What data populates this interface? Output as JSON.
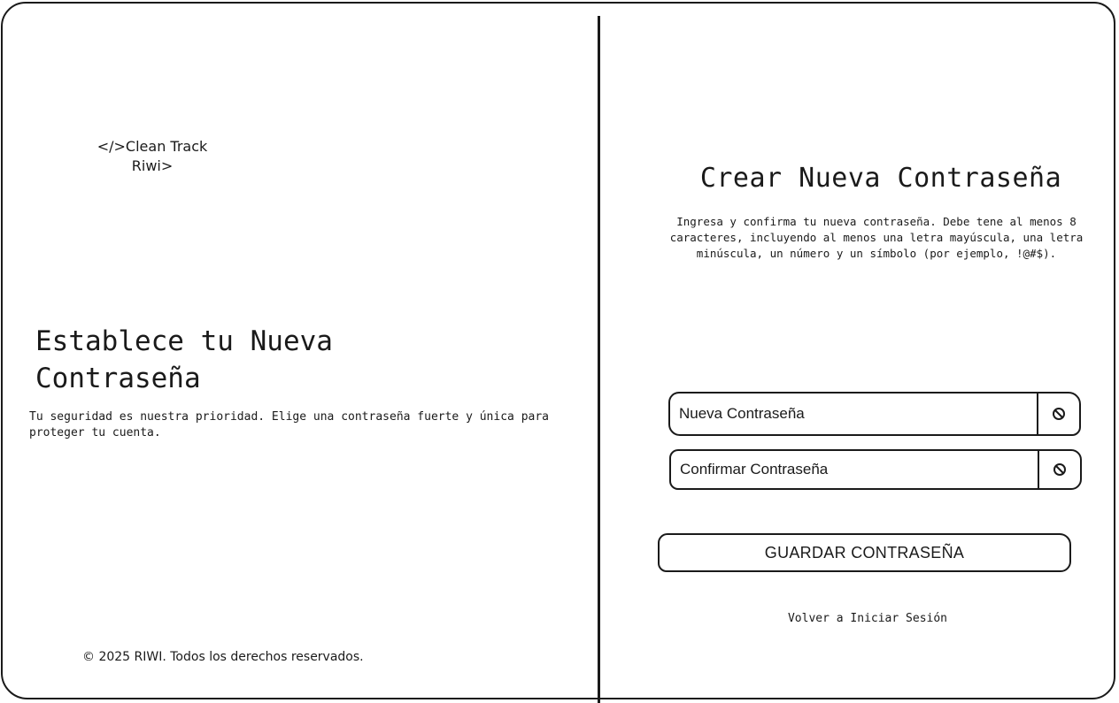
{
  "brand": {
    "logo_line1": "</>Clean Track",
    "logo_line2": "Riwi>"
  },
  "left_panel": {
    "title_line1": "Establece tu Nueva",
    "title_line2": "Contraseña",
    "description": "Tu seguridad es nuestra prioridad. Elige una contraseña fuerte y única para proteger tu cuenta.",
    "copyright": "© 2025 RIWI. Todos los derechos reservados."
  },
  "form": {
    "title": "Crear Nueva Contraseña",
    "instructions": "Ingresa y confirma tu nueva contraseña. Debe tene al menos 8 caracteres, incluyendo al menos una letra mayúscula, una letra minúscula, un número y un símbolo (por ejemplo, !@#$).",
    "new_password": {
      "placeholder": "Nueva Contraseña",
      "value": "",
      "toggle_icon": "eye-off-icon"
    },
    "confirm_password": {
      "placeholder": "Confirmar Contraseña",
      "value": "",
      "toggle_icon": "eye-off-icon"
    },
    "submit_label": "GUARDAR CONTRASEÑA",
    "back_link": "Volver a Iniciar Sesión"
  },
  "colors": {
    "ink": "#1a1a1a",
    "background": "#ffffff"
  }
}
